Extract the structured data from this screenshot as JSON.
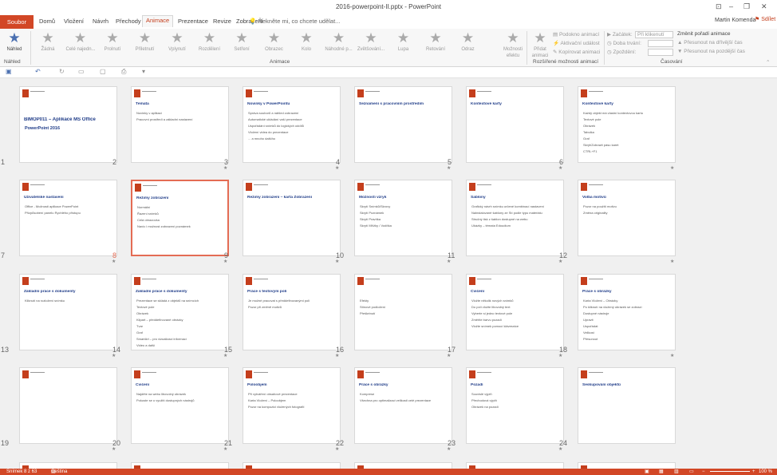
{
  "titlebar": {
    "doc_title": "2016-powerpoint-II.pptx - PowerPoint",
    "user": "Martin Komenda",
    "share": "Sdílet"
  },
  "tabs": [
    "Soubor",
    "Domů",
    "Vložení",
    "Návrh",
    "Přechody",
    "Animace",
    "Prezentace",
    "Revize",
    "Zobrazení"
  ],
  "active_tab": "Animace",
  "tellme": "Řekněte mi, co chcete udělat...",
  "ribbon": {
    "nahled": "Náhled",
    "nahled_group": "Náhled",
    "animations": [
      "Žádná",
      "Celé najedn...",
      "Prolnutí",
      "Přiletnutí",
      "Vplynutí",
      "Rozdělení",
      "Setření",
      "Obrazec",
      "Kolo",
      "Náhodné p...",
      "Zvětšování...",
      "Lupa",
      "Retování",
      "Odraz"
    ],
    "moznosti": "Možnosti efektu",
    "animace_group": "Animace",
    "pridat": "Přidat animaci",
    "podokno": "Podokno animací",
    "aktivacni": "Aktivační událost",
    "kopirovat": "Kopírovat animaci",
    "rozsirene_group": "Rozšířené možnosti animací",
    "zacatek": "Začátek:",
    "zacatek_val": "Při klikenutí",
    "doba": "Doba trvání:",
    "zpozdeni": "Zpoždění:",
    "zmenit": "Změnit pořadí animace",
    "drive": "Přesunout na dřívější čas",
    "pozdeji": "Přesunout na pozdější čas",
    "casovani_group": "Časování"
  },
  "slides": [
    {
      "n": "1",
      "title": "BIMOP011 – Aplikace MS Office",
      "lines": [
        "PowerPoint 2016"
      ],
      "star": false
    },
    {
      "n": "2",
      "title": "Témata",
      "lines": [
        "Novinky v aplikaci",
        "Pracovní prostředí a základní nastavení"
      ],
      "star": true
    },
    {
      "n": "3",
      "title": "Novinky v PowerPointu",
      "lines": [
        "Správa souborů a náhled zobrazení",
        "Automatické ukládání vaší prezentace",
        "Uspořádání snímků do logických oddílů",
        "Vložení videa do prezentace",
        "... a mnoho dalšího"
      ],
      "star": true
    },
    {
      "n": "4",
      "title": "Seznámení s pracovním prostředím",
      "lines": [],
      "star": true
    },
    {
      "n": "5",
      "title": "Kontextové karty",
      "lines": [],
      "star": true
    },
    {
      "n": "6",
      "title": "Kontextové karty",
      "lines": [
        "Každý objekt má vlastní kontextovou kartu",
        "Textové pole",
        "Obrázek",
        "Tabulka",
        "Graf",
        "Skrýt/Zobrazit pásu karet",
        "CTRL+F1"
      ],
      "star": true
    },
    {
      "n": "7",
      "title": "Uživatelské nastavení",
      "lines": [
        "Office - Možnosti aplikace PowerPoint",
        "Přizpůsobení panelu Rychlého přístupu"
      ],
      "star": true
    },
    {
      "n": "8",
      "title": "Režimy zobrazení",
      "lines": [
        "Normální",
        "Řazení snímků",
        "Celá obrazovka",
        "Navíc i možnost zobrazení poznámek"
      ],
      "star": true
    },
    {
      "n": "9",
      "title": "Režimy zobrazení – karta Zobrazení",
      "lines": [],
      "star": true
    },
    {
      "n": "10",
      "title": "Možnosti vzryk",
      "lines": [
        "Skrytí Snímků/Skrovy",
        "Skrytí Poznámek",
        "Skrytí Pravítka",
        "Skrytí Mřížky / Vodítka"
      ],
      "star": true
    },
    {
      "n": "11",
      "title": "Šablony",
      "lines": [
        "Grafický návrh snímku určené kombinací nastavení",
        "Nainstalované šablony ze Stí podle typu materiálu",
        "Stručný tisk z šablon dostupné na webu",
        "Ukázky – témata Edoudium"
      ],
      "star": true
    },
    {
      "n": "12",
      "title": "Volba motivů",
      "lines": [
        "Pozor na použití motivu",
        "Změna originality"
      ],
      "star": true
    },
    {
      "n": "13",
      "title": "Základní práce s dokumenty",
      "lines": [
        "Kliknutí na rozložení snímku"
      ],
      "star": true
    },
    {
      "n": "14",
      "title": "Základní práce s dokumenty",
      "lines": [
        "Prezentace se skládá z objektů na snímcích",
        "Textové pole",
        "Obrázek",
        "Klipart – předdefinované obrázky",
        "Tvar",
        "Graf",
        "SmartArt – pro vizualizaci informací",
        "Video a další"
      ],
      "star": true
    },
    {
      "n": "15",
      "title": "Práce s textovým polí",
      "lines": [
        "Je možné pracovat s předdefinovanými poli",
        "Pozor při změně motivů"
      ],
      "star": true
    },
    {
      "n": "16",
      "title": "",
      "lines": [
        "Efekty",
        "Stínové podložení",
        "Přeškrtnutí"
      ],
      "star": true
    },
    {
      "n": "17",
      "title": "Cvičení",
      "lines": [
        "Vložte několik nových snímků",
        "Do polí vložte libovolný text",
        "Vyberte si jedno textové pole",
        "Změňte barvu pozadí",
        "Vložte snímek pomocí klávesnice"
      ],
      "star": true
    },
    {
      "n": "18",
      "title": "Práce s obrázky",
      "lines": [
        "Karta Vložení – Obrázky",
        "Po kliknutí na vložený obrázek se zobrazí",
        "Dostupné nástroje",
        "Upravit",
        "Uspořádat",
        "Velikost",
        "Přesunout"
      ],
      "star": true
    },
    {
      "n": "19",
      "title": "",
      "lines": [],
      "star": true
    },
    {
      "n": "20",
      "title": "Cvičení",
      "lines": [
        "Najděte na webu libovolný obrázek",
        "Pokuste se o využití dostupných nástrojů"
      ],
      "star": true
    },
    {
      "n": "21",
      "title": "Poloobjem",
      "lines": [
        "Při vytváření obsahové prezentace",
        "Karta Vložení – Poloobjem",
        "Pozor na kompozici vložených fotografií"
      ],
      "star": true
    },
    {
      "n": "22",
      "title": "Práce s obrázky",
      "lines": [
        "Komprese",
        "Všechna pro optimalizaci velikosti celé prezentace"
      ],
      "star": true
    },
    {
      "n": "23",
      "title": "Pozadí",
      "lines": [
        "Souvislé výplň",
        "Přechodová výplň",
        "Obrázek na pozadí"
      ],
      "star": true
    },
    {
      "n": "24",
      "title": "Seskupování objektů",
      "lines": [],
      "star": false
    }
  ],
  "status": {
    "slide": "Snímek 8 z 63",
    "lang": "Čeština",
    "zoom": "100 %"
  },
  "colors": {
    "accent": "#d24726",
    "selection": "#e46c54",
    "title_blue": "#1f3c88"
  }
}
